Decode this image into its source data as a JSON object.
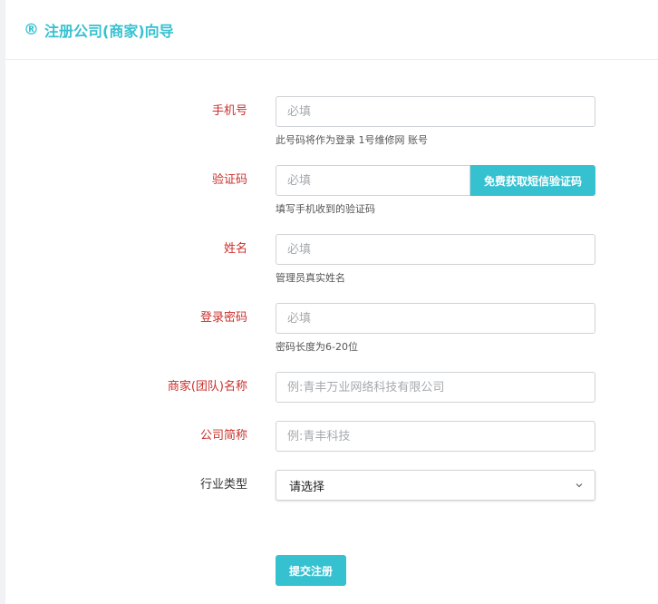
{
  "header": {
    "icon": "registered-icon",
    "icon_glyph": "®",
    "title": "注册公司(商家)向导"
  },
  "form": {
    "phone": {
      "label": "手机号",
      "placeholder": "必填",
      "hint": "此号码将作为登录 1号维修网 账号"
    },
    "code": {
      "label": "验证码",
      "placeholder": "必填",
      "button": "免费获取短信验证码",
      "hint": "填写手机收到的验证码"
    },
    "name": {
      "label": "姓名",
      "placeholder": "必填",
      "hint": "管理员真实姓名"
    },
    "password": {
      "label": "登录密码",
      "placeholder": "必填",
      "hint": "密码长度为6-20位"
    },
    "merchant": {
      "label": "商家(团队)名称",
      "placeholder": "例:青丰万业网络科技有限公司"
    },
    "short_name": {
      "label": "公司简称",
      "placeholder": "例:青丰科技"
    },
    "industry": {
      "label": "行业类型",
      "selected": "请选择"
    },
    "submit": "提交注册"
  },
  "colors": {
    "accent": "#36c1d0",
    "required_label": "#c9302c"
  }
}
